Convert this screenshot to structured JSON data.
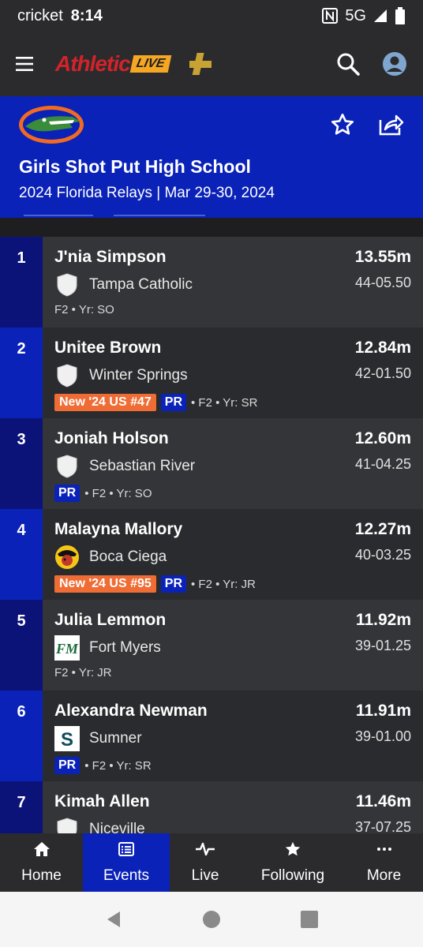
{
  "status_bar": {
    "carrier": "cricket",
    "time": "8:14",
    "network": "5G"
  },
  "app_header": {
    "logo_main": "Athletic",
    "logo_live": "LIVE",
    "menu_icon": "hamburger-icon",
    "search_icon": "search-icon",
    "account_icon": "account-icon"
  },
  "event": {
    "title": "Girls Shot Put High School",
    "subtitle": "2024 Florida Relays | Mar 29-30, 2024",
    "favorite_icon": "star-icon",
    "share_icon": "share-icon"
  },
  "results": [
    {
      "place": "1",
      "name": "J'nia Simpson",
      "school": "Tampa Catholic",
      "mark": "13.55m",
      "imperial": "44-05.50",
      "badge_new": "",
      "pr": false,
      "meta": "F2 • Yr: SO",
      "logo": "shield"
    },
    {
      "place": "2",
      "name": "Unitee Brown",
      "school": "Winter Springs",
      "mark": "12.84m",
      "imperial": "42-01.50",
      "badge_new": "New '24 US #47",
      "pr": true,
      "meta": "• F2 • Yr: SR",
      "logo": "shield"
    },
    {
      "place": "3",
      "name": "Joniah Holson",
      "school": "Sebastian River",
      "mark": "12.60m",
      "imperial": "41-04.25",
      "badge_new": "",
      "pr": true,
      "meta": "• F2 • Yr: SO",
      "logo": "shield"
    },
    {
      "place": "4",
      "name": "Malayna Mallory",
      "school": "Boca Ciega",
      "mark": "12.27m",
      "imperial": "40-03.25",
      "badge_new": "New '24 US #95",
      "pr": true,
      "meta": "• F2 • Yr: JR",
      "logo": "pirate"
    },
    {
      "place": "5",
      "name": "Julia Lemmon",
      "school": "Fort Myers",
      "mark": "11.92m",
      "imperial": "39-01.25",
      "badge_new": "",
      "pr": false,
      "meta": "F2 • Yr: JR",
      "logo": "fm"
    },
    {
      "place": "6",
      "name": "Alexandra Newman",
      "school": "Sumner",
      "mark": "11.91m",
      "imperial": "39-01.00",
      "badge_new": "",
      "pr": true,
      "meta": "• F2 • Yr: SR",
      "logo": "s"
    },
    {
      "place": "7",
      "name": "Kimah Allen",
      "school": "Niceville",
      "mark": "11.46m",
      "imperial": "37-07.25",
      "badge_new": "",
      "pr": false,
      "meta": "",
      "logo": "shield"
    }
  ],
  "pr_label": "PR",
  "bottom_nav": [
    {
      "label": "Home",
      "icon": "home-icon",
      "active": false
    },
    {
      "label": "Events",
      "icon": "list-icon",
      "active": true
    },
    {
      "label": "Live",
      "icon": "pulse-icon",
      "active": false
    },
    {
      "label": "Following",
      "icon": "star-icon",
      "active": false
    },
    {
      "label": "More",
      "icon": "more-icon",
      "active": false
    }
  ],
  "colors": {
    "brand_blue": "#0a22b8",
    "dark_blue": "#0b1378",
    "badge_orange": "#ef6c35",
    "logo_red": "#d2232a",
    "logo_gold": "#f5a623"
  }
}
